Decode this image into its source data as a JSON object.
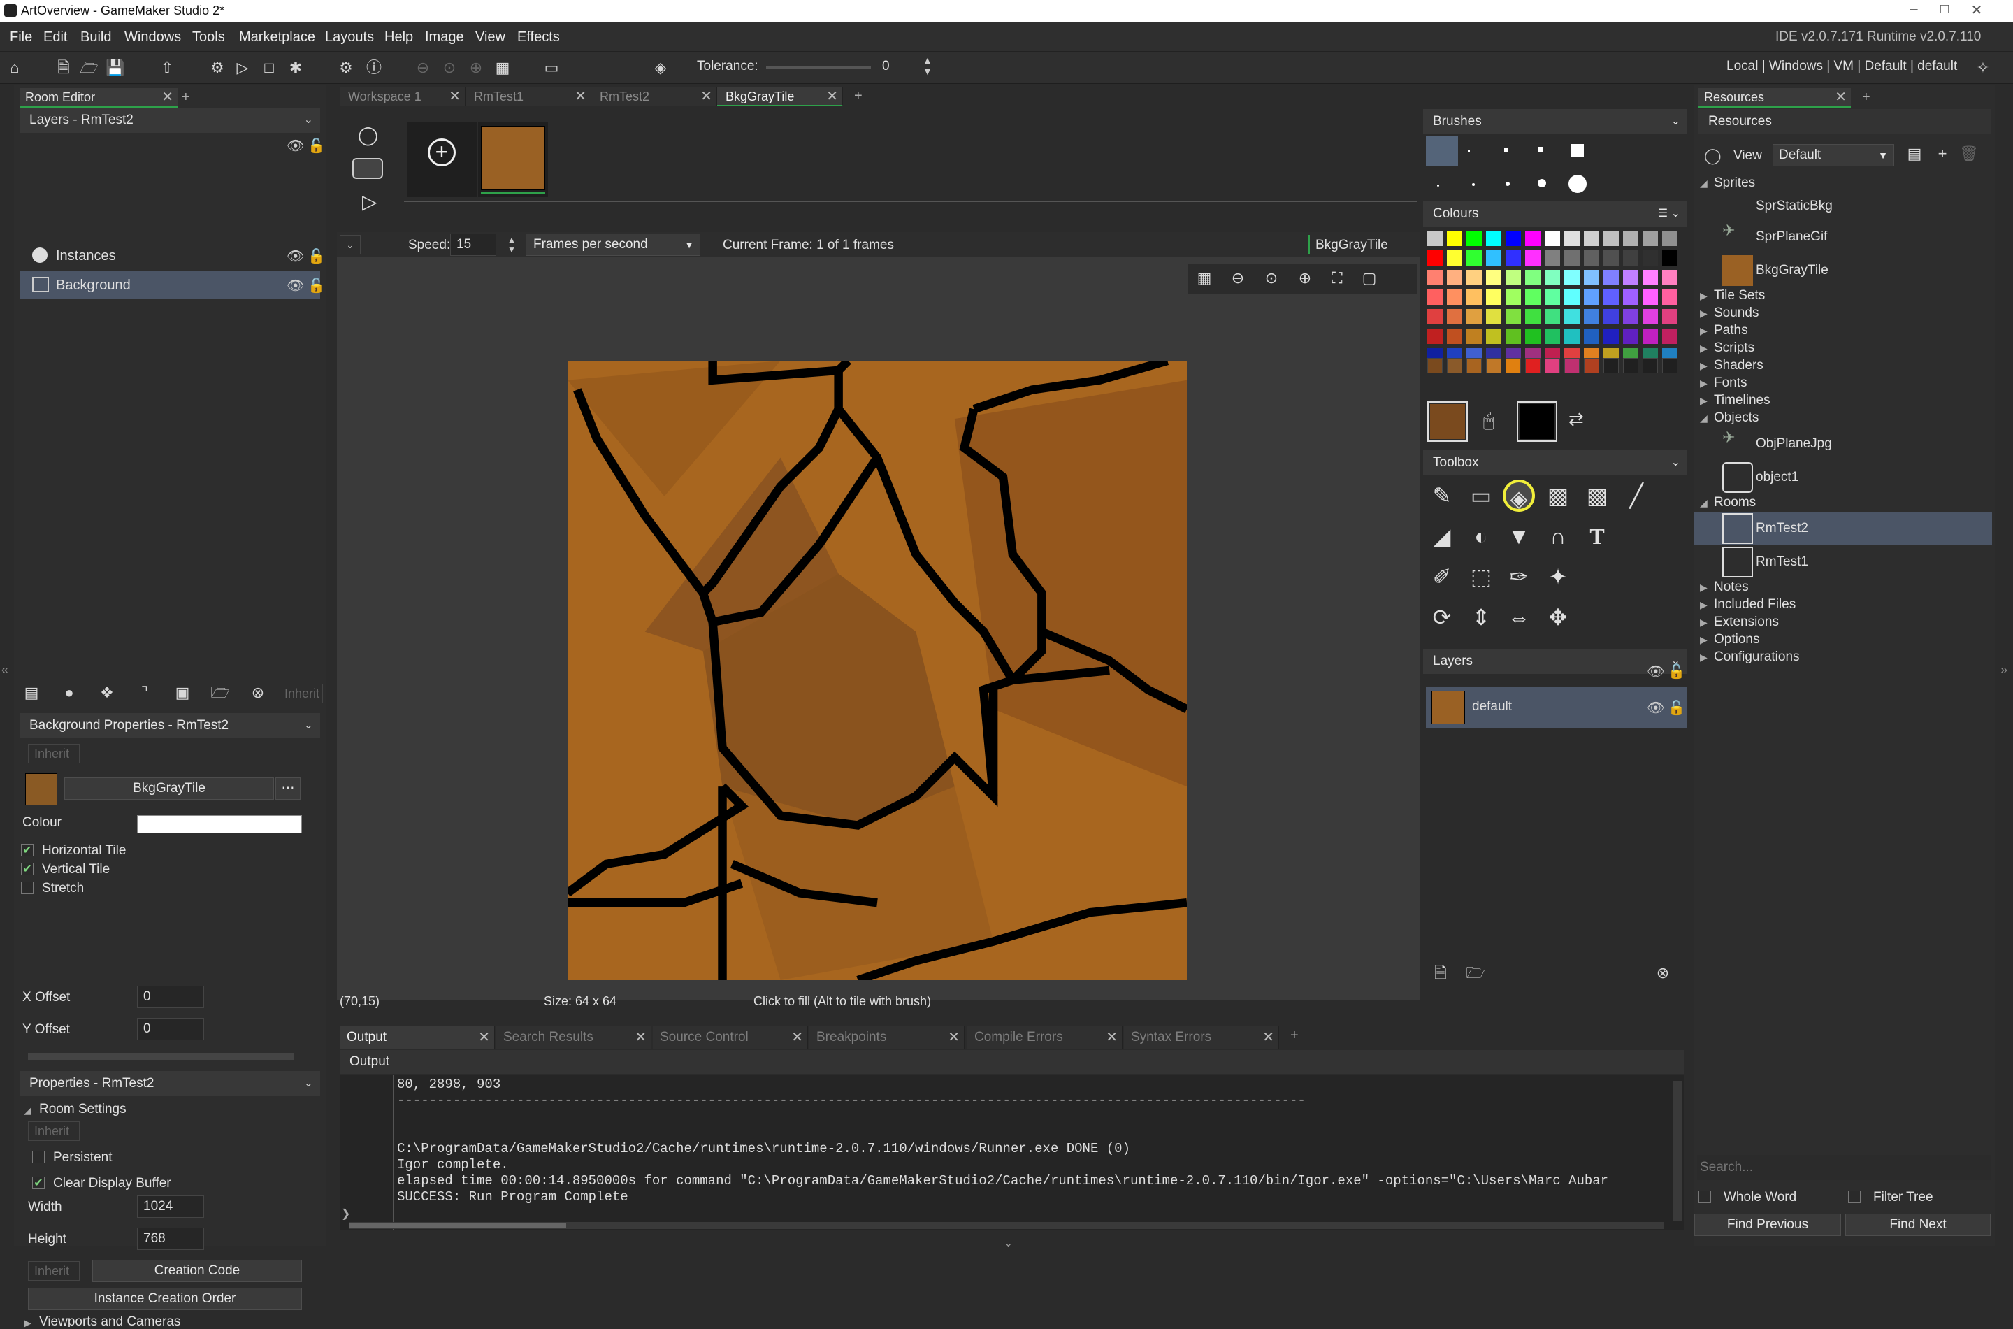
{
  "window": {
    "title": "ArtOverview - GameMaker Studio 2*"
  },
  "menu": {
    "items": [
      "File",
      "Edit",
      "Build",
      "Windows",
      "Tools",
      "Marketplace",
      "Layouts",
      "Help",
      "Image",
      "View",
      "Effects"
    ],
    "ide_version": "IDE v2.0.7.171 Runtime v2.0.7.110"
  },
  "toolbar": {
    "tolerance_label": "Tolerance:",
    "tolerance_value": "0",
    "target": "Local | Windows | VM | Default | default"
  },
  "room_editor": {
    "tab": "Room Editor",
    "layers_header": "Layers - RmTest2",
    "layers": [
      "Instances",
      "Background"
    ],
    "inherit_label": "Inherit",
    "bg_props_header": "Background Properties - RmTest2",
    "bg_sprite": "BkgGrayTile",
    "colour_label": "Colour",
    "htile_label": "Horizontal Tile",
    "vtile_label": "Vertical Tile",
    "stretch_label": "Stretch",
    "xoffset_label": "X Offset",
    "xoffset": "0",
    "yoffset_label": "Y Offset",
    "yoffset": "0",
    "props_header": "Properties - RmTest2",
    "room_settings": "Room Settings",
    "persistent_label": "Persistent",
    "clear_label": "Clear Display Buffer",
    "width_label": "Width",
    "width": "1024",
    "height_label": "Height",
    "height": "768",
    "creation_code": "Creation Code",
    "instance_order": "Instance Creation Order",
    "viewports": "Viewports and Cameras"
  },
  "doc_tabs": [
    "Workspace 1",
    "RmTest1",
    "RmTest2",
    "BkgGrayTile"
  ],
  "sprite_editor": {
    "speed_label": "Speed:",
    "speed": "15",
    "fps_mode": "Frames per second",
    "current_frame": "Current Frame: 1 of 1 frames",
    "sprite_name": "BkgGrayTile",
    "coords": "(70,15)",
    "size": "Size: 64 x 64",
    "hint": "Click to fill (Alt to tile with brush)"
  },
  "image_panel": {
    "brushes": "Brushes",
    "colours": "Colours",
    "toolbox": "Toolbox",
    "layers": "Layers",
    "layer_name": "default",
    "primary_colour": "#7a4a1e",
    "secondary_colour": "#000000",
    "swatches": [
      [
        "#c8c8c8",
        "#ffff00",
        "#00ff00",
        "#00ffff",
        "#0000ff",
        "#ff00ff",
        "#ffffff",
        "#e0e0e0",
        "#d0d0d0",
        "#c0c0c0",
        "#b0b0b0",
        "#a0a0a0",
        "#909090"
      ],
      [
        "#ff0000",
        "#ffff30",
        "#30ff30",
        "#30c0ff",
        "#3030ff",
        "#ff30ff",
        "#808080",
        "#707070",
        "#606060",
        "#505050",
        "#404040",
        "#303030",
        "#000000"
      ],
      [
        "#ff8070",
        "#ffb080",
        "#ffd080",
        "#ffff80",
        "#c0ff80",
        "#80ff80",
        "#80ffc0",
        "#80ffff",
        "#80c0ff",
        "#8080ff",
        "#c080ff",
        "#ff80ff",
        "#ff80c0"
      ],
      [
        "#ff6060",
        "#ff9060",
        "#ffc060",
        "#ffff60",
        "#a0ff60",
        "#60ff60",
        "#60ffa0",
        "#60ffff",
        "#60a0ff",
        "#6060ff",
        "#a060ff",
        "#ff60ff",
        "#ff60a0"
      ],
      [
        "#e04040",
        "#e07040",
        "#e0a040",
        "#e0e040",
        "#80e040",
        "#40e040",
        "#40e080",
        "#40e0e0",
        "#4080e0",
        "#4040e0",
        "#8040e0",
        "#e040e0",
        "#e04080"
      ],
      [
        "#c02020",
        "#c05020",
        "#c08020",
        "#c0c020",
        "#60c020",
        "#20c020",
        "#20c060",
        "#20c0c0",
        "#2060c0",
        "#2020c0",
        "#6020c0",
        "#c020c0",
        "#c02060"
      ],
      [
        "#1020a0",
        "#2040c0",
        "#4060d0",
        "#3030a0",
        "#6030a0",
        "#a03080",
        "#c02050",
        "#e04040",
        "#e08020",
        "#c0a020",
        "#40a040",
        "#208060",
        "#2080c0"
      ]
    ],
    "recent": [
      "#7a4a1e",
      "#8a5a2a",
      "#a86420",
      "#c07828",
      "#e08010",
      "#e02020",
      "#e04080",
      "#c03070",
      "#b04020",
      "#202020",
      "#202020",
      "#202020",
      "#202020"
    ]
  },
  "resources": {
    "tab": "Resources",
    "header": "Resources",
    "view_label": "View",
    "view_value": "Default",
    "tree": [
      {
        "label": "Sprites",
        "level": 0,
        "open": true
      },
      {
        "label": "SprStaticBkg",
        "level": 1
      },
      {
        "label": "SprPlaneGif",
        "level": 1
      },
      {
        "label": "BkgGrayTile",
        "level": 1
      },
      {
        "label": "Tile Sets",
        "level": 0
      },
      {
        "label": "Sounds",
        "level": 0
      },
      {
        "label": "Paths",
        "level": 0
      },
      {
        "label": "Scripts",
        "level": 0
      },
      {
        "label": "Shaders",
        "level": 0
      },
      {
        "label": "Fonts",
        "level": 0
      },
      {
        "label": "Timelines",
        "level": 0
      },
      {
        "label": "Objects",
        "level": 0,
        "open": true
      },
      {
        "label": "ObjPlaneJpg",
        "level": 1
      },
      {
        "label": "object1",
        "level": 1
      },
      {
        "label": "Rooms",
        "level": 0,
        "open": true
      },
      {
        "label": "RmTest2",
        "level": 1,
        "selected": true
      },
      {
        "label": "RmTest1",
        "level": 1
      },
      {
        "label": "Notes",
        "level": 0
      },
      {
        "label": "Included Files",
        "level": 0
      },
      {
        "label": "Extensions",
        "level": 0
      },
      {
        "label": "Options",
        "level": 0
      },
      {
        "label": "Configurations",
        "level": 0
      }
    ],
    "search_placeholder": "Search...",
    "whole_word": "Whole Word",
    "filter_tree": "Filter Tree",
    "find_prev": "Find Previous",
    "find_next": "Find Next"
  },
  "output": {
    "tabs": [
      "Output",
      "Search Results",
      "Source Control",
      "Breakpoints",
      "Compile Errors",
      "Syntax Errors"
    ],
    "header": "Output",
    "lines": [
      "80, 2898, 903",
      "------------------------------------------------------------------------------------------------------------------",
      "",
      "",
      "C:\\ProgramData/GameMakerStudio2/Cache/runtimes\\runtime-2.0.7.110/windows/Runner.exe DONE (0)",
      "Igor complete.",
      "elapsed time 00:00:14.8950000s for command \"C:\\ProgramData/GameMakerStudio2/Cache/runtimes\\runtime-2.0.7.110/bin/Igor.exe\" -options=\"C:\\Users\\Marc Aubar",
      "SUCCESS: Run Program Complete"
    ]
  }
}
